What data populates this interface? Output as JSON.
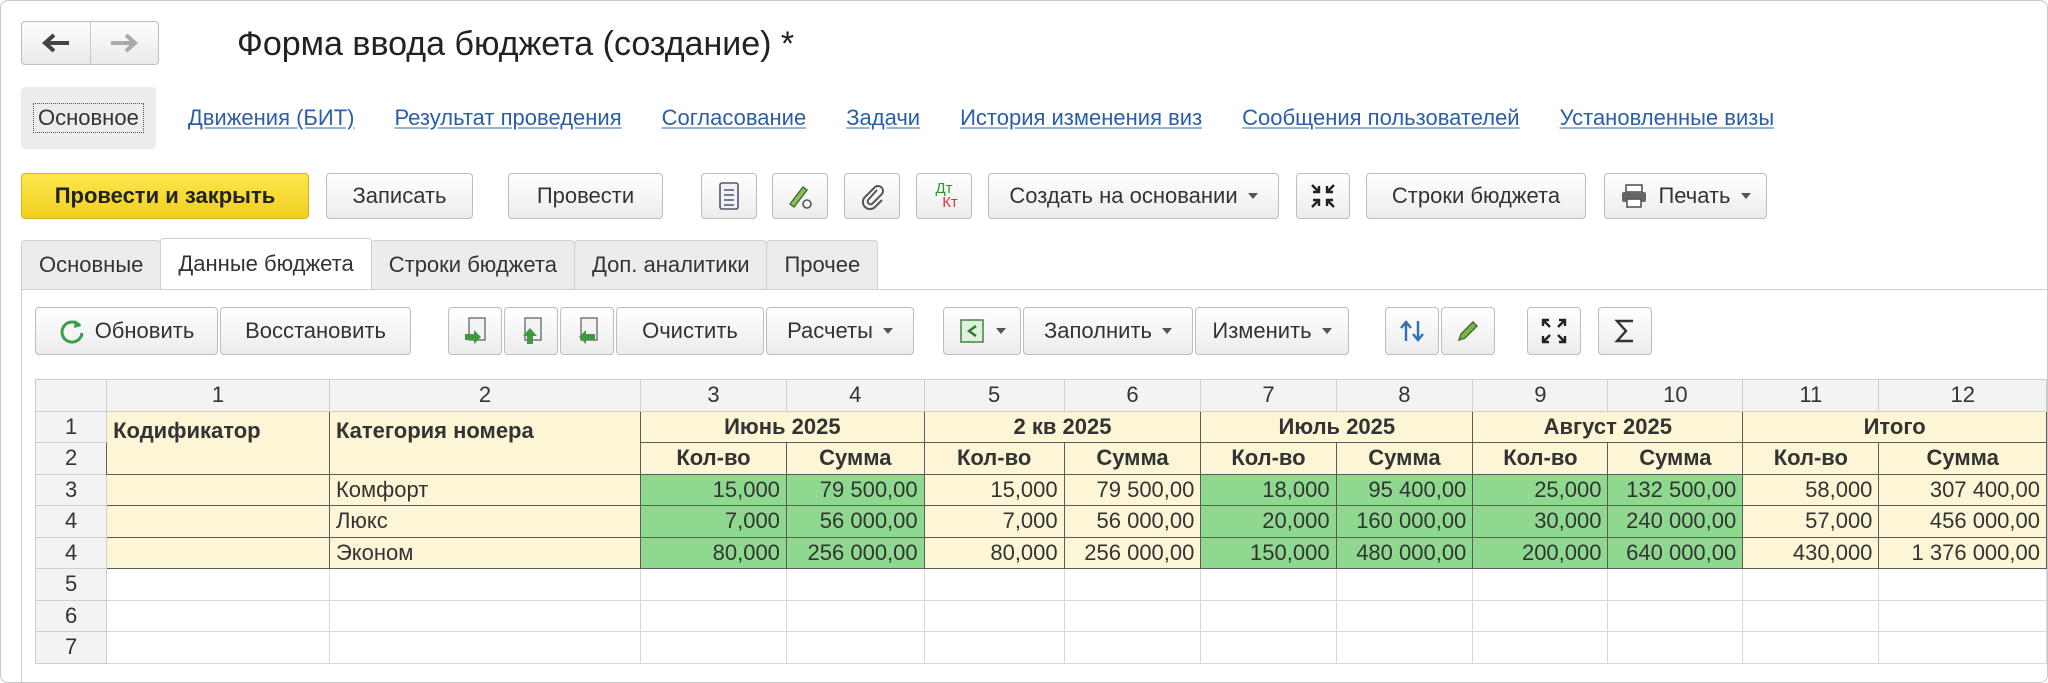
{
  "header": {
    "title": "Форма ввода бюджета (создание) *"
  },
  "links": {
    "active": "Основное",
    "items": [
      "Движения (БИТ)",
      "Результат проведения",
      "Согласование",
      "Задачи",
      "История изменения виз",
      "Сообщения пользователей",
      "Установленные визы"
    ]
  },
  "commands": {
    "post_close": "Провести и закрыть",
    "save": "Записать",
    "post": "Провести",
    "create_based": "Создать на основании",
    "budget_rows": "Строки бюджета",
    "print": "Печать",
    "dtkt_top": "Дт",
    "dtkt_bottom": "Кт"
  },
  "tabs": [
    "Основные",
    "Данные бюджета",
    "Строки бюджета",
    "Доп. аналитики",
    "Прочее"
  ],
  "toolbar": {
    "refresh": "Обновить",
    "restore": "Восстановить",
    "clear": "Очистить",
    "calcs": "Расчеты",
    "fill": "Заполнить",
    "change": "Изменить"
  },
  "table": {
    "col_numbers": [
      "1",
      "2",
      "3",
      "4",
      "5",
      "6",
      "7",
      "8",
      "9",
      "10",
      "11",
      "12"
    ],
    "row_numbers": [
      "1",
      "2",
      "3",
      "4",
      "4",
      "5",
      "6",
      "7"
    ],
    "head_codifier": "Кодификатор",
    "head_category": "Категория номера",
    "periods": [
      "Июнь 2025",
      "2 кв 2025",
      "Июль 2025",
      "Август 2025",
      "Итого"
    ],
    "qty": "Кол-во",
    "sum": "Сумма",
    "rows": [
      {
        "category": "Комфорт",
        "values": [
          "15,000",
          "79 500,00",
          "15,000",
          "79 500,00",
          "18,000",
          "95 400,00",
          "25,000",
          "132 500,00",
          "58,000",
          "307 400,00"
        ]
      },
      {
        "category": "Люкс",
        "values": [
          "7,000",
          "56 000,00",
          "7,000",
          "56 000,00",
          "20,000",
          "160 000,00",
          "30,000",
          "240 000,00",
          "57,000",
          "456 000,00"
        ]
      },
      {
        "category": "Эконом",
        "values": [
          "80,000",
          "256 000,00",
          "80,000",
          "256 000,00",
          "150,000",
          "480 000,00",
          "200,000",
          "640 000,00",
          "430,000",
          "1 376 000,00"
        ]
      }
    ]
  },
  "colors": {
    "primary_button": "#f5d623",
    "highlight_cell": "#8fd88f",
    "header_cell": "#fcf5d6",
    "link": "#2b5ea8"
  }
}
